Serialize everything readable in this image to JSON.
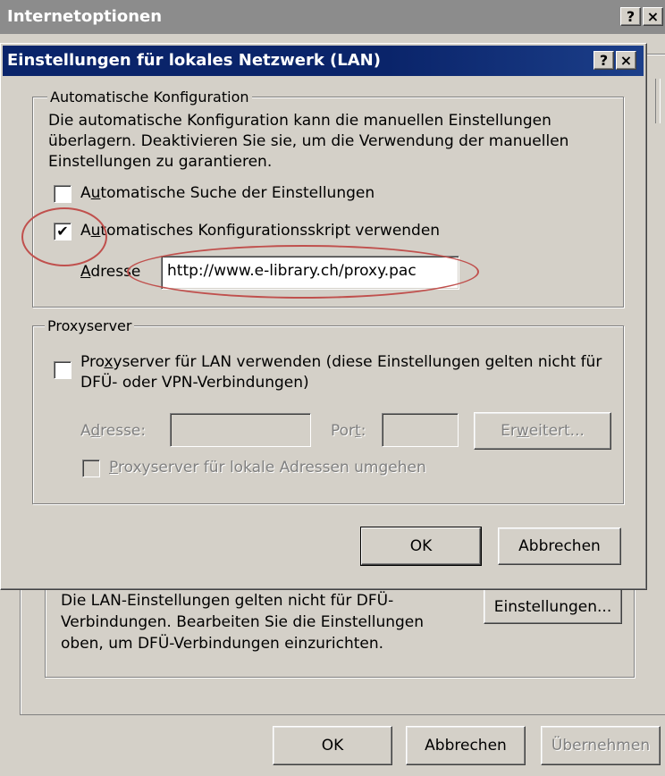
{
  "outer": {
    "title": "Internetoptionen",
    "help_label": "?",
    "close_label": "×",
    "lan_info_text": "Die LAN-Einstellungen gelten nicht für DFÜ-Verbindungen. Bearbeiten Sie die Einstellungen oben, um DFÜ-Verbindungen einzurichten.",
    "settings_button": "Einstellungen...",
    "ok_button": "OK",
    "cancel_button": "Abbrechen",
    "apply_button": "Übernehmen"
  },
  "dialog": {
    "title": "Einstellungen für lokales Netzwerk (LAN)",
    "help_label": "?",
    "close_label": "×",
    "auto_config": {
      "legend": "Automatische Konfiguration",
      "description": "Die automatische Konfiguration kann die manuellen Einstellungen überlagern. Deaktivieren Sie sie, um die Verwendung der manuellen Einstellungen zu garantieren.",
      "auto_detect_label": "Automatische Suche der Einstellungen",
      "auto_detect_checked": false,
      "use_script_label": "Automatisches Konfigurationsskript verwenden",
      "use_script_checked": true,
      "address_label": "Adresse",
      "address_value": "http://www.e-library.ch/proxy.pac"
    },
    "proxy": {
      "legend": "Proxyserver",
      "use_proxy_label": "Proxyserver für LAN verwenden (diese Einstellungen gelten nicht für DFÜ- oder VPN-Verbindungen)",
      "use_proxy_checked": false,
      "address_label": "Adresse:",
      "address_value": "",
      "port_label": "Port:",
      "port_value": "",
      "advanced_button": "Erweitert...",
      "bypass_label": "Proxyserver für lokale Adressen umgehen",
      "bypass_checked": false
    },
    "ok_button": "OK",
    "cancel_button": "Abbrechen"
  },
  "annotation_color": "#c0504d"
}
